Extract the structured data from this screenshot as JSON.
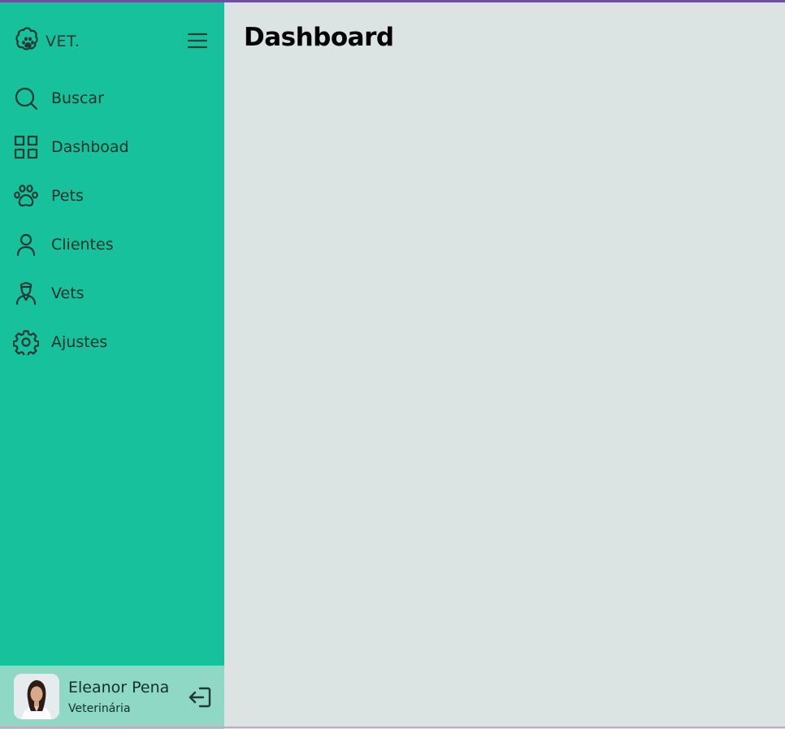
{
  "brand": {
    "logo_text": "VET."
  },
  "sidebar": {
    "items": [
      {
        "label": "Buscar",
        "icon": "search-icon"
      },
      {
        "label": "Dashboad",
        "icon": "grid-icon"
      },
      {
        "label": "Pets",
        "icon": "paw-icon"
      },
      {
        "label": "Clientes",
        "icon": "user-icon"
      },
      {
        "label": "Vets",
        "icon": "vet-icon"
      },
      {
        "label": "Ajustes",
        "icon": "gear-icon"
      }
    ]
  },
  "profile": {
    "name": "Eleanor Pena",
    "role": "Veterinária"
  },
  "main": {
    "title": "Dashboard"
  },
  "colors": {
    "sidebar_bg": "#17c19c",
    "profile_bg": "#8fd8c6",
    "main_bg": "#dce3e3",
    "top_accent": "#6e4fa8"
  }
}
